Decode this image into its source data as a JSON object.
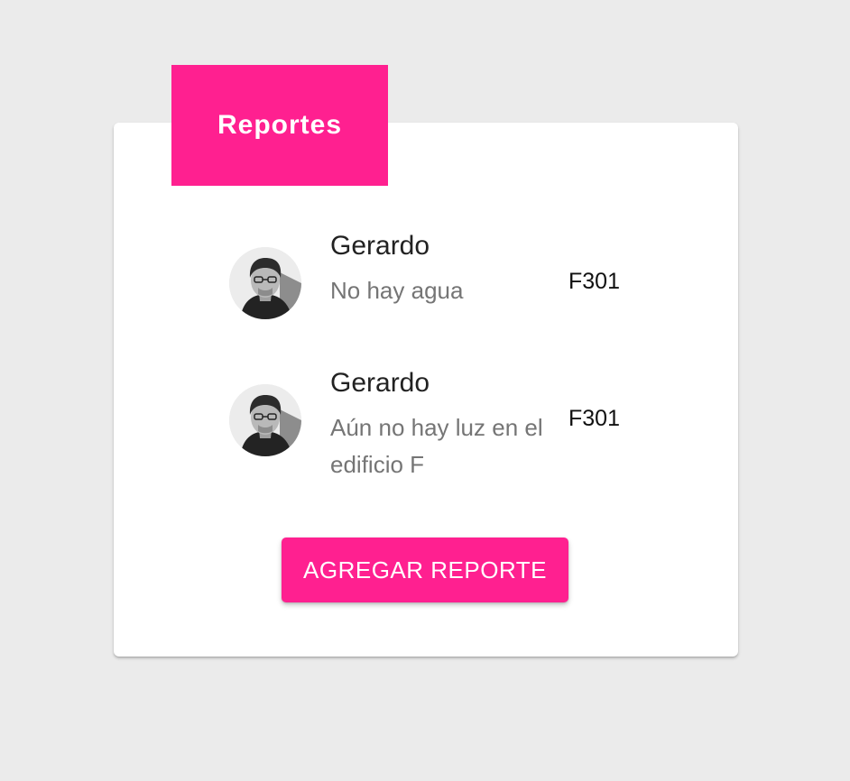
{
  "card": {
    "title": "Reportes",
    "accent_color": "#ff2090"
  },
  "reports": [
    {
      "name": "Gerardo",
      "message": "No hay agua",
      "code": "F301",
      "avatar_icon": "user-photo"
    },
    {
      "name": "Gerardo",
      "message": "Aún no hay luz en el edificio F",
      "code": "F301",
      "avatar_icon": "user-photo"
    }
  ],
  "actions": {
    "add_report_label": "AGREGAR REPORTE"
  }
}
